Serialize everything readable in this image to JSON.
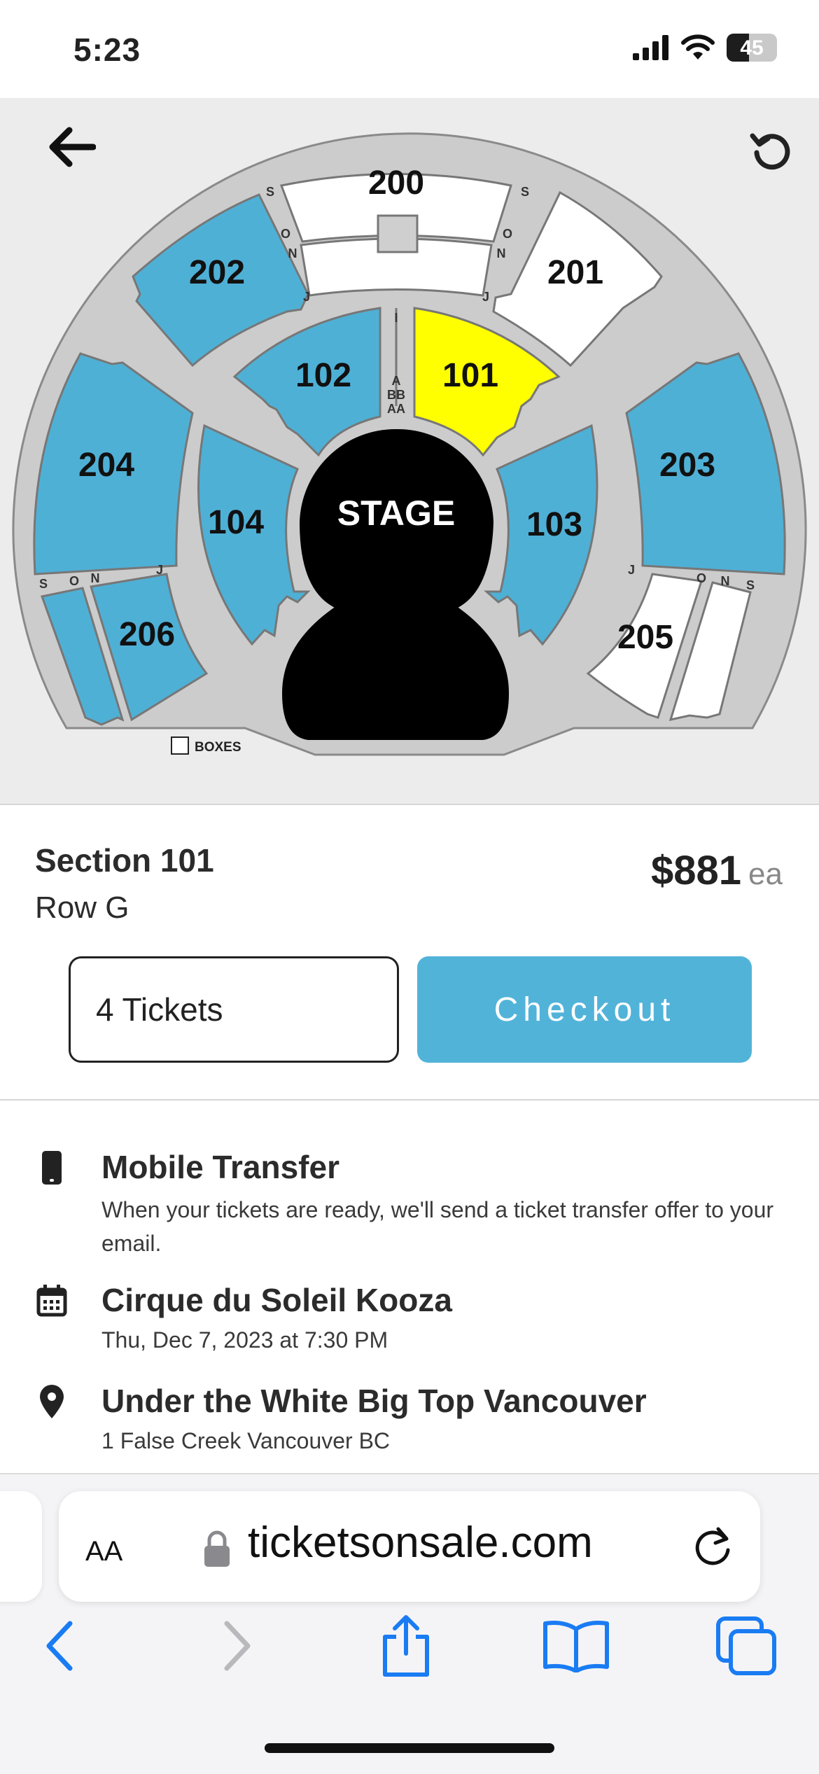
{
  "status_bar": {
    "time": "5:23",
    "battery": "45",
    "battery_level": 0.45
  },
  "seat_map": {
    "sections": {
      "s200": "200",
      "s201": "201",
      "s202": "202",
      "s203": "203",
      "s204": "204",
      "s205": "205",
      "s206": "206",
      "s101": "101",
      "s102": "102",
      "s103": "103",
      "s104": "104"
    },
    "stage": "STAGE",
    "row_labels": {
      "s": "S",
      "o": "O",
      "n": "N",
      "j": "J",
      "i": "I",
      "a": "A",
      "bb": "BB",
      "aa": "AA"
    },
    "legend_boxes": "BOXES",
    "colors": {
      "available": "#4fb0d6",
      "selected": "#ffff00",
      "unavailable": "#ffffff",
      "concourse": "#cccccc",
      "stage": "#000000"
    }
  },
  "ticket": {
    "section": "Section 101",
    "row": "Row G",
    "price": "$881",
    "price_unit": "ea",
    "quantity": "4 Tickets",
    "checkout_label": "Checkout"
  },
  "info": [
    {
      "icon": "phone-icon",
      "title": "Mobile Transfer",
      "subtitle": "When your tickets are ready, we'll send a ticket transfer offer to your email."
    },
    {
      "icon": "calendar-icon",
      "title": "Cirque du Soleil Kooza",
      "subtitle": "Thu, Dec 7, 2023 at 7:30 PM"
    },
    {
      "icon": "location-pin-icon",
      "title": "Under the White Big Top Vancouver",
      "subtitle": "1 False Creek Vancouver BC"
    }
  ],
  "browser": {
    "text_size_button": "AA",
    "url": "ticketsonsale.com"
  }
}
